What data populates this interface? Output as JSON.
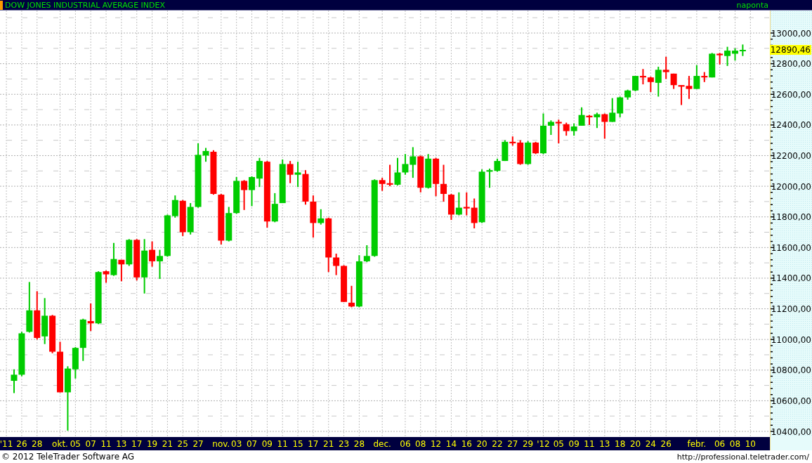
{
  "header": {
    "title": "DOW JONES INDUSTRIAL AVERAGE INDEX",
    "period": "naponta"
  },
  "chart": {
    "last_price": "12890,46",
    "chart_data": {
      "type": "candlestick",
      "grid": true,
      "ylim": [
        10400,
        13000
      ],
      "yticks": [
        {
          "value": 10400,
          "label": "10400,00"
        },
        {
          "value": 10600,
          "label": "10600,00"
        },
        {
          "value": 10800,
          "label": "10800,00"
        },
        {
          "value": 11000,
          "label": "11000,00"
        },
        {
          "value": 11200,
          "label": "11200,00"
        },
        {
          "value": 11400,
          "label": "11400,00"
        },
        {
          "value": 11600,
          "label": "11600,00"
        },
        {
          "value": 11800,
          "label": "11800,00"
        },
        {
          "value": 12000,
          "label": "12000,00"
        },
        {
          "value": 12200,
          "label": "12200,00"
        },
        {
          "value": 12400,
          "label": "12400,00"
        },
        {
          "value": 12600,
          "label": "12600,00"
        },
        {
          "value": 12800,
          "label": "12800,00"
        },
        {
          "value": 13000,
          "label": "13000,00"
        }
      ],
      "categories": [
        "'11",
        null,
        "26",
        null,
        "28",
        null,
        null,
        "okt.",
        null,
        "05",
        null,
        "07",
        null,
        "11",
        null,
        "13",
        null,
        "17",
        null,
        "19",
        null,
        "21",
        null,
        "25",
        null,
        "27",
        null,
        null,
        "nov.",
        null,
        "03",
        null,
        "07",
        null,
        "09",
        null,
        "11",
        null,
        "15",
        null,
        "17",
        null,
        "21",
        null,
        "23",
        null,
        "28",
        null,
        null,
        "dec.",
        null,
        null,
        "06",
        null,
        "08",
        null,
        "12",
        null,
        "14",
        null,
        "16",
        null,
        "20",
        null,
        "22",
        null,
        "27",
        null,
        "29",
        null,
        "'12",
        null,
        "05",
        null,
        "09",
        null,
        "11",
        null,
        "13",
        null,
        "18",
        null,
        "20",
        null,
        "24",
        null,
        "26",
        null,
        null,
        null,
        "febr.",
        null,
        null,
        "06",
        null,
        "08",
        null,
        "10"
      ],
      "ohlc": [
        null,
        [
          10730,
          10805,
          10650,
          10770
        ],
        [
          10770,
          11050,
          10760,
          11040
        ],
        [
          11050,
          11375,
          11045,
          11190
        ],
        [
          11190,
          11315,
          11000,
          11010
        ],
        [
          11020,
          11270,
          10970,
          11155
        ],
        [
          11155,
          11160,
          10910,
          10920
        ],
        [
          10920,
          10985,
          10655,
          10655
        ],
        [
          10655,
          10825,
          10405,
          10810
        ],
        [
          10805,
          10950,
          10745,
          10945
        ],
        [
          10945,
          11135,
          10860,
          11130
        ],
        [
          11120,
          11235,
          11055,
          11105
        ],
        [
          11105,
          11445,
          11100,
          11440
        ],
        [
          11445,
          11450,
          11370,
          11425
        ],
        [
          11420,
          11630,
          11415,
          11525
        ],
        [
          11520,
          11520,
          11380,
          11490
        ],
        [
          11490,
          11655,
          11480,
          11650
        ],
        [
          11650,
          11655,
          11385,
          11405
        ],
        [
          11405,
          11655,
          11300,
          11580
        ],
        [
          11585,
          11640,
          11475,
          11510
        ],
        [
          11510,
          11585,
          11395,
          11545
        ],
        [
          11545,
          11815,
          11540,
          11810
        ],
        [
          11805,
          11940,
          11795,
          11910
        ],
        [
          11905,
          11910,
          11675,
          11700
        ],
        [
          11700,
          11890,
          11685,
          11865
        ],
        [
          11865,
          12280,
          11860,
          12205
        ],
        [
          12200,
          12250,
          12160,
          12230
        ],
        [
          12225,
          12235,
          11945,
          11950
        ],
        [
          11945,
          11950,
          11620,
          11645
        ],
        [
          11645,
          11865,
          11640,
          11825
        ],
        [
          11825,
          12060,
          11820,
          12035
        ],
        [
          12035,
          12040,
          11845,
          11975
        ],
        [
          11975,
          12065,
          11870,
          12060
        ],
        [
          12050,
          12185,
          11995,
          12165
        ],
        [
          12160,
          12165,
          11730,
          11770
        ],
        [
          11770,
          11955,
          11765,
          11885
        ],
        [
          11890,
          12175,
          11890,
          12145
        ],
        [
          12145,
          12165,
          12020,
          12075
        ],
        [
          12075,
          12160,
          11995,
          12090
        ],
        [
          12080,
          12105,
          11880,
          11900
        ],
        [
          11900,
          11940,
          11665,
          11760
        ],
        [
          11760,
          11850,
          11750,
          11790
        ],
        [
          11790,
          11795,
          11440,
          11535
        ],
        [
          11535,
          11560,
          11420,
          11480
        ],
        [
          11480,
          11485,
          11245,
          11245
        ],
        [
          11240,
          11350,
          11210,
          11215
        ],
        [
          11215,
          11550,
          11210,
          11510
        ],
        [
          11510,
          11615,
          11505,
          11545
        ],
        [
          11545,
          12045,
          11540,
          12040
        ],
        [
          12040,
          12055,
          11970,
          12015
        ],
        [
          12020,
          12140,
          12000,
          12010
        ],
        [
          12010,
          12185,
          12005,
          12090
        ],
        [
          12090,
          12210,
          12075,
          12145
        ],
        [
          12140,
          12255,
          12055,
          12195
        ],
        [
          12195,
          12200,
          11960,
          11990
        ],
        [
          11990,
          12210,
          11985,
          12180
        ],
        [
          12180,
          12185,
          11935,
          12015
        ],
        [
          12015,
          12140,
          11900,
          11950
        ],
        [
          11945,
          11950,
          11780,
          11815
        ],
        [
          11815,
          11960,
          11810,
          11860
        ],
        [
          11865,
          11960,
          11810,
          11855
        ],
        [
          11860,
          11920,
          11725,
          11760
        ],
        [
          11765,
          12110,
          11760,
          12095
        ],
        [
          12095,
          12115,
          11990,
          12105
        ],
        [
          12100,
          12180,
          12095,
          12165
        ],
        [
          12165,
          12300,
          12165,
          12290
        ],
        [
          12290,
          12325,
          12265,
          12280
        ],
        [
          12285,
          12300,
          12140,
          12145
        ],
        [
          12145,
          12295,
          12140,
          12285
        ],
        [
          12285,
          12290,
          12210,
          12215
        ],
        [
          12215,
          12475,
          12210,
          12395
        ],
        [
          12395,
          12430,
          12335,
          12420
        ],
        [
          12420,
          12435,
          12280,
          12410
        ],
        [
          12405,
          12415,
          12330,
          12360
        ],
        [
          12360,
          12410,
          12330,
          12390
        ],
        [
          12395,
          12515,
          12395,
          12465
        ],
        [
          12460,
          12465,
          12400,
          12450
        ],
        [
          12450,
          12480,
          12380,
          12470
        ],
        [
          12470,
          12475,
          12310,
          12420
        ],
        [
          12420,
          12575,
          12420,
          12480
        ],
        [
          12475,
          12585,
          12450,
          12580
        ],
        [
          12580,
          12630,
          12565,
          12625
        ],
        [
          12625,
          12720,
          12620,
          12720
        ],
        [
          12720,
          12765,
          12665,
          12710
        ],
        [
          12710,
          12715,
          12615,
          12680
        ],
        [
          12675,
          12780,
          12585,
          12760
        ],
        [
          12760,
          12845,
          12700,
          12745
        ],
        [
          12735,
          12735,
          12635,
          12660
        ],
        [
          12660,
          12660,
          12530,
          12650
        ],
        [
          12655,
          12720,
          12570,
          12635
        ],
        [
          12635,
          12790,
          12635,
          12720
        ],
        [
          12720,
          12745,
          12680,
          12710
        ],
        [
          12710,
          12870,
          12710,
          12865
        ],
        [
          12865,
          12870,
          12795,
          12855
        ],
        [
          12850,
          12910,
          12785,
          12885
        ],
        [
          12865,
          12900,
          12820,
          12885
        ],
        [
          12885,
          12925,
          12850,
          12890
        ],
        null
      ]
    }
  },
  "footer": {
    "copyright": "© 2012 TeleTrader Software AG",
    "url": "http://professional.teletrader.com/"
  }
}
